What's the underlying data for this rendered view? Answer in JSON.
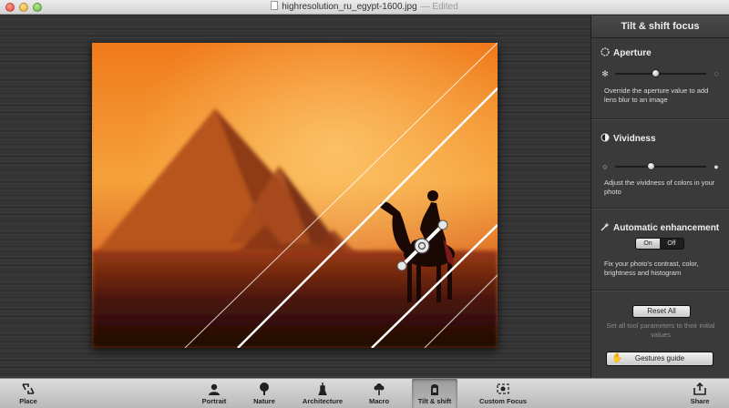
{
  "window": {
    "filename": "highresolution_ru_egypt-1600.jpg",
    "status": "— Edited"
  },
  "panel": {
    "title": "Tilt & shift focus",
    "aperture": {
      "heading": "Aperture",
      "description": "Override the aperture value to add lens blur to an image",
      "level": 0.45
    },
    "vividness": {
      "heading": "Vividness",
      "description": "Adjust the vividness of colors in your photo",
      "level": 0.4
    },
    "enhancement": {
      "heading": "Automatic enhancement",
      "on_label": "On",
      "off_label": "Off",
      "selected": "On",
      "description": "Fix your photo's contrast, color, brightness and histogram"
    },
    "reset": {
      "button_label": "Reset All",
      "description": "Set all tool parameters to their initial values"
    },
    "gestures": {
      "button_label": "Gestures guide"
    }
  },
  "toolbar": {
    "place": "Place",
    "portrait": "Portrait",
    "nature": "Nature",
    "architecture": "Architecture",
    "macro": "Macro",
    "tilt_shift": "Tilt & shift",
    "custom_focus": "Custom Focus",
    "share": "Share",
    "active": "Tilt & shift"
  }
}
